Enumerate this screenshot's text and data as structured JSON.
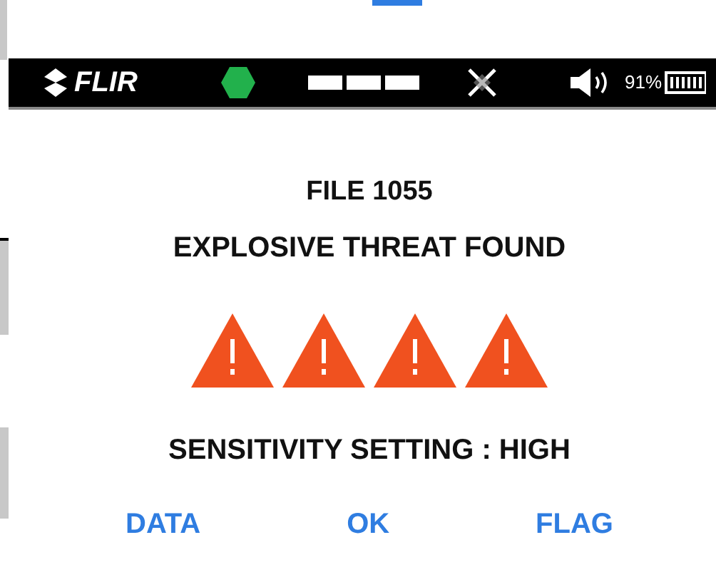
{
  "status_bar": {
    "logo": "FLIR",
    "status_light": {
      "color": "#22b14c"
    },
    "volume_on": true,
    "battery": "91%"
  },
  "file": "FILE 1055",
  "alert": "EXPLOSIVE THREAT FOUND",
  "threat": {
    "stars": 4
  },
  "sensitivity": "SENSITIVITY SETTING : HIGH",
  "buttons": [
    "DATA",
    "OK",
    "FLAG"
  ]
}
